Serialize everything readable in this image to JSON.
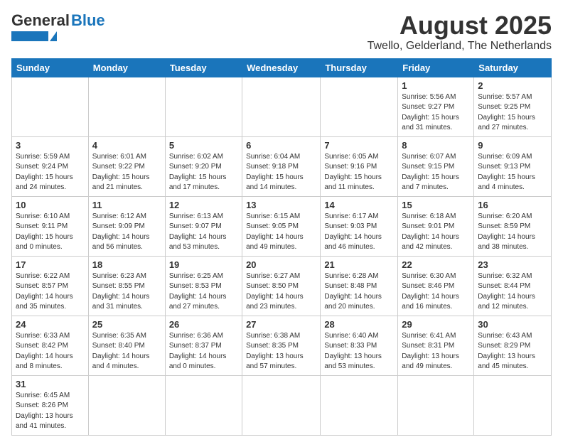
{
  "header": {
    "logo_general": "General",
    "logo_blue": "Blue",
    "month_title": "August 2025",
    "location": "Twello, Gelderland, The Netherlands"
  },
  "days_of_week": [
    "Sunday",
    "Monday",
    "Tuesday",
    "Wednesday",
    "Thursday",
    "Friday",
    "Saturday"
  ],
  "weeks": [
    [
      {
        "day": "",
        "info": ""
      },
      {
        "day": "",
        "info": ""
      },
      {
        "day": "",
        "info": ""
      },
      {
        "day": "",
        "info": ""
      },
      {
        "day": "",
        "info": ""
      },
      {
        "day": "1",
        "info": "Sunrise: 5:56 AM\nSunset: 9:27 PM\nDaylight: 15 hours and 31 minutes."
      },
      {
        "day": "2",
        "info": "Sunrise: 5:57 AM\nSunset: 9:25 PM\nDaylight: 15 hours and 27 minutes."
      }
    ],
    [
      {
        "day": "3",
        "info": "Sunrise: 5:59 AM\nSunset: 9:24 PM\nDaylight: 15 hours and 24 minutes."
      },
      {
        "day": "4",
        "info": "Sunrise: 6:01 AM\nSunset: 9:22 PM\nDaylight: 15 hours and 21 minutes."
      },
      {
        "day": "5",
        "info": "Sunrise: 6:02 AM\nSunset: 9:20 PM\nDaylight: 15 hours and 17 minutes."
      },
      {
        "day": "6",
        "info": "Sunrise: 6:04 AM\nSunset: 9:18 PM\nDaylight: 15 hours and 14 minutes."
      },
      {
        "day": "7",
        "info": "Sunrise: 6:05 AM\nSunset: 9:16 PM\nDaylight: 15 hours and 11 minutes."
      },
      {
        "day": "8",
        "info": "Sunrise: 6:07 AM\nSunset: 9:15 PM\nDaylight: 15 hours and 7 minutes."
      },
      {
        "day": "9",
        "info": "Sunrise: 6:09 AM\nSunset: 9:13 PM\nDaylight: 15 hours and 4 minutes."
      }
    ],
    [
      {
        "day": "10",
        "info": "Sunrise: 6:10 AM\nSunset: 9:11 PM\nDaylight: 15 hours and 0 minutes."
      },
      {
        "day": "11",
        "info": "Sunrise: 6:12 AM\nSunset: 9:09 PM\nDaylight: 14 hours and 56 minutes."
      },
      {
        "day": "12",
        "info": "Sunrise: 6:13 AM\nSunset: 9:07 PM\nDaylight: 14 hours and 53 minutes."
      },
      {
        "day": "13",
        "info": "Sunrise: 6:15 AM\nSunset: 9:05 PM\nDaylight: 14 hours and 49 minutes."
      },
      {
        "day": "14",
        "info": "Sunrise: 6:17 AM\nSunset: 9:03 PM\nDaylight: 14 hours and 46 minutes."
      },
      {
        "day": "15",
        "info": "Sunrise: 6:18 AM\nSunset: 9:01 PM\nDaylight: 14 hours and 42 minutes."
      },
      {
        "day": "16",
        "info": "Sunrise: 6:20 AM\nSunset: 8:59 PM\nDaylight: 14 hours and 38 minutes."
      }
    ],
    [
      {
        "day": "17",
        "info": "Sunrise: 6:22 AM\nSunset: 8:57 PM\nDaylight: 14 hours and 35 minutes."
      },
      {
        "day": "18",
        "info": "Sunrise: 6:23 AM\nSunset: 8:55 PM\nDaylight: 14 hours and 31 minutes."
      },
      {
        "day": "19",
        "info": "Sunrise: 6:25 AM\nSunset: 8:53 PM\nDaylight: 14 hours and 27 minutes."
      },
      {
        "day": "20",
        "info": "Sunrise: 6:27 AM\nSunset: 8:50 PM\nDaylight: 14 hours and 23 minutes."
      },
      {
        "day": "21",
        "info": "Sunrise: 6:28 AM\nSunset: 8:48 PM\nDaylight: 14 hours and 20 minutes."
      },
      {
        "day": "22",
        "info": "Sunrise: 6:30 AM\nSunset: 8:46 PM\nDaylight: 14 hours and 16 minutes."
      },
      {
        "day": "23",
        "info": "Sunrise: 6:32 AM\nSunset: 8:44 PM\nDaylight: 14 hours and 12 minutes."
      }
    ],
    [
      {
        "day": "24",
        "info": "Sunrise: 6:33 AM\nSunset: 8:42 PM\nDaylight: 14 hours and 8 minutes."
      },
      {
        "day": "25",
        "info": "Sunrise: 6:35 AM\nSunset: 8:40 PM\nDaylight: 14 hours and 4 minutes."
      },
      {
        "day": "26",
        "info": "Sunrise: 6:36 AM\nSunset: 8:37 PM\nDaylight: 14 hours and 0 minutes."
      },
      {
        "day": "27",
        "info": "Sunrise: 6:38 AM\nSunset: 8:35 PM\nDaylight: 13 hours and 57 minutes."
      },
      {
        "day": "28",
        "info": "Sunrise: 6:40 AM\nSunset: 8:33 PM\nDaylight: 13 hours and 53 minutes."
      },
      {
        "day": "29",
        "info": "Sunrise: 6:41 AM\nSunset: 8:31 PM\nDaylight: 13 hours and 49 minutes."
      },
      {
        "day": "30",
        "info": "Sunrise: 6:43 AM\nSunset: 8:29 PM\nDaylight: 13 hours and 45 minutes."
      }
    ],
    [
      {
        "day": "31",
        "info": "Sunrise: 6:45 AM\nSunset: 8:26 PM\nDaylight: 13 hours and 41 minutes."
      },
      {
        "day": "",
        "info": ""
      },
      {
        "day": "",
        "info": ""
      },
      {
        "day": "",
        "info": ""
      },
      {
        "day": "",
        "info": ""
      },
      {
        "day": "",
        "info": ""
      },
      {
        "day": "",
        "info": ""
      }
    ]
  ]
}
